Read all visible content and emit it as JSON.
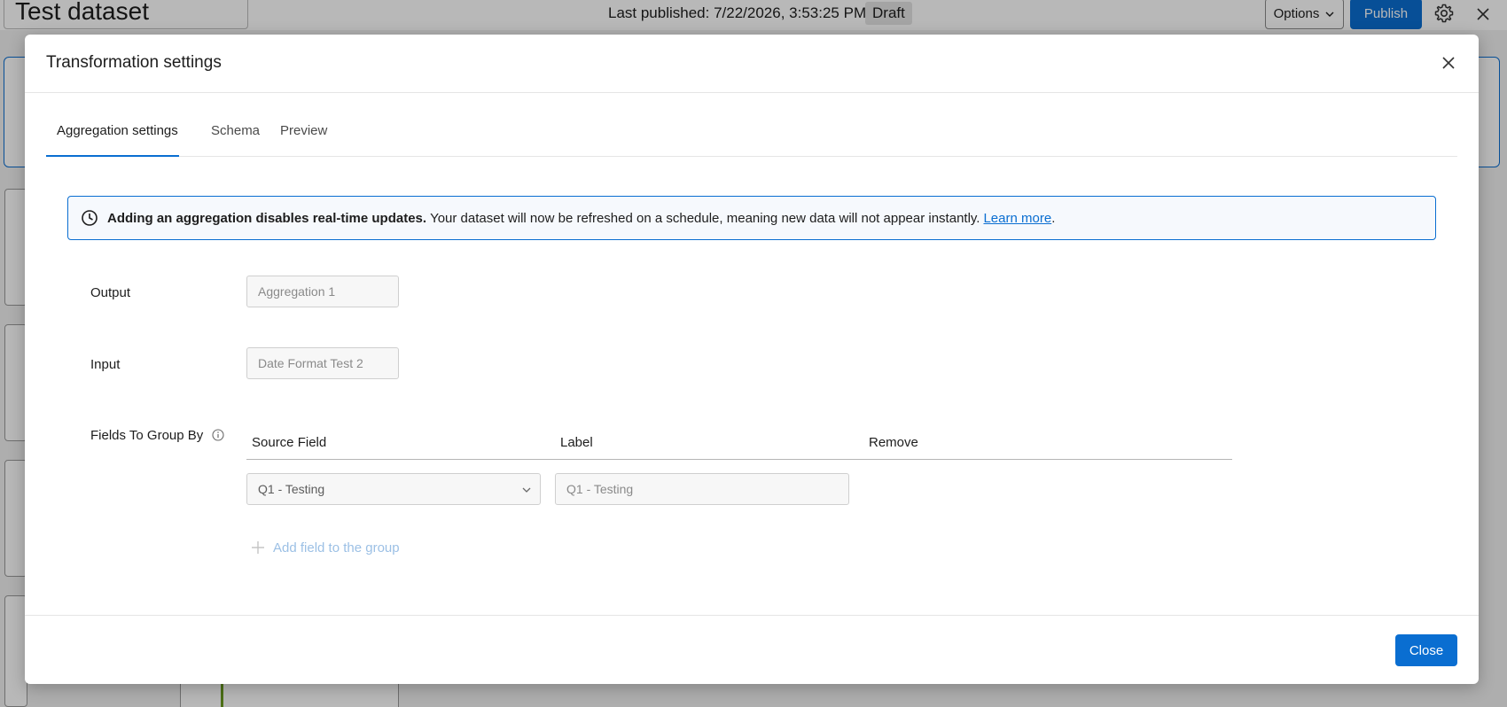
{
  "app": {
    "dataset_title": "Test dataset",
    "last_published": "Last published: 7/22/2026, 3:53:25 PM",
    "status_badge": "Draft",
    "options_label": "Options",
    "publish_label": "Publish",
    "icons": {
      "settings": "gear-icon",
      "close": "close-icon",
      "options_chevron": "chevron-down-icon"
    }
  },
  "modal": {
    "title": "Transformation settings",
    "tabs": [
      {
        "label": "Aggregation settings",
        "active": true
      },
      {
        "label": "Schema",
        "active": false
      },
      {
        "label": "Preview",
        "active": false
      }
    ],
    "alert": {
      "icon": "clock-icon",
      "bold_text": "Adding an aggregation disables real-time updates.",
      "text": "Your dataset will now be refreshed on a schedule, meaning new data will not appear instantly.",
      "link_text": "Learn more",
      "trailing": "."
    },
    "form": {
      "output_label": "Output",
      "output_placeholder": "Aggregation 1",
      "input_label": "Input",
      "input_placeholder": "Date Format Test 2",
      "group_by_label": "Fields To Group By",
      "group_by_info_icon": "info-icon",
      "columns": [
        "Source Field",
        "Label",
        "Remove"
      ],
      "rows": [
        {
          "source_field": "Q1 - Testing",
          "label_placeholder": "Q1 - Testing"
        }
      ],
      "add_field_label": "Add field to the group"
    },
    "footer": {
      "close_label": "Close"
    }
  },
  "colors": {
    "accent": "#0a6ed1",
    "overlay": "rgba(0,0,0,0.28)",
    "link_disabled": "#9cc0e5"
  }
}
